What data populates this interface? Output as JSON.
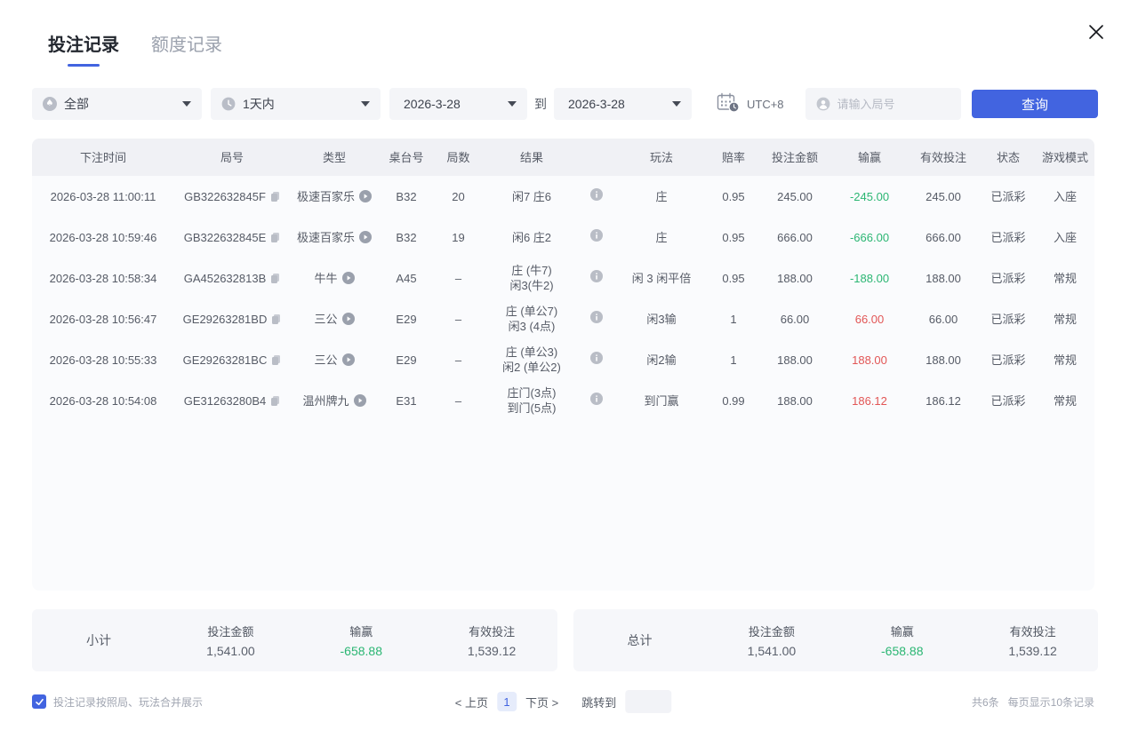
{
  "header": {
    "tabs": [
      {
        "label": "投注记录",
        "active": true
      },
      {
        "label": "额度记录",
        "active": false
      }
    ]
  },
  "filters": {
    "game_type": {
      "value": "全部",
      "icon": "spade-circle-icon"
    },
    "time_range": {
      "value": "1天内",
      "icon": "clock-icon"
    },
    "date_from": "2026-3-28",
    "to_label": "到",
    "date_to": "2026-3-28",
    "timezone": {
      "label": "UTC+8",
      "icon": "calendar-clock-icon"
    },
    "search": {
      "placeholder": "请输入局号",
      "icon": "person-icon"
    },
    "query_button": "查询"
  },
  "table": {
    "columns": [
      "下注时间",
      "局号",
      "类型",
      "桌台号",
      "局数",
      "结果",
      "",
      "玩法",
      "赔率",
      "投注金额",
      "输赢",
      "有效投注",
      "状态",
      "游戏模式"
    ],
    "rows": [
      {
        "time": "2026-03-28 11:00:11",
        "id": "GB322632845F",
        "type": "极速百家乐",
        "table_no": "B32",
        "rounds": "20",
        "result1": "闲7 庄6",
        "result2": "",
        "play": "庄",
        "odds": "0.95",
        "bet": "245.00",
        "winloss": "-245.00",
        "winloss_class": "neg",
        "valid": "245.00",
        "status": "已派彩",
        "mode": "入座"
      },
      {
        "time": "2026-03-28 10:59:46",
        "id": "GB322632845E",
        "type": "极速百家乐",
        "table_no": "B32",
        "rounds": "19",
        "result1": "闲6 庄2",
        "result2": "",
        "play": "庄",
        "odds": "0.95",
        "bet": "666.00",
        "winloss": "-666.00",
        "winloss_class": "neg",
        "valid": "666.00",
        "status": "已派彩",
        "mode": "入座"
      },
      {
        "time": "2026-03-28 10:58:34",
        "id": "GA452632813B",
        "type": "牛牛",
        "table_no": "A45",
        "rounds": "–",
        "result1": "庄 (牛7)",
        "result2": "闲3(牛2)",
        "play": "闲 3 闲平倍",
        "odds": "0.95",
        "bet": "188.00",
        "winloss": "-188.00",
        "winloss_class": "neg",
        "valid": "188.00",
        "status": "已派彩",
        "mode": "常规"
      },
      {
        "time": "2026-03-28 10:56:47",
        "id": "GE29263281BD",
        "type": "三公",
        "table_no": "E29",
        "rounds": "–",
        "result1": "庄 (单公7)",
        "result2": "闲3 (4点)",
        "play": "闲3输",
        "odds": "1",
        "bet": "66.00",
        "winloss": "66.00",
        "winloss_class": "pos",
        "valid": "66.00",
        "status": "已派彩",
        "mode": "常规"
      },
      {
        "time": "2026-03-28 10:55:33",
        "id": "GE29263281BC",
        "type": "三公",
        "table_no": "E29",
        "rounds": "–",
        "result1": "庄 (单公3)",
        "result2": "闲2 (单公2)",
        "play": "闲2输",
        "odds": "1",
        "bet": "188.00",
        "winloss": "188.00",
        "winloss_class": "pos",
        "valid": "188.00",
        "status": "已派彩",
        "mode": "常规"
      },
      {
        "time": "2026-03-28 10:54:08",
        "id": "GE31263280B4",
        "type": "温州牌九",
        "table_no": "E31",
        "rounds": "–",
        "result1": "庄门(3点)",
        "result2": "到门(5点)",
        "play": "到门赢",
        "odds": "0.99",
        "bet": "188.00",
        "winloss": "186.12",
        "winloss_class": "pos",
        "valid": "186.12",
        "status": "已派彩",
        "mode": "常规"
      }
    ]
  },
  "summary": {
    "subtotal": {
      "label": "小计",
      "bet_caption": "投注金额",
      "bet": "1,541.00",
      "winloss_caption": "输赢",
      "winloss": "-658.88",
      "winloss_class": "neg",
      "valid_caption": "有效投注",
      "valid": "1,539.12"
    },
    "total": {
      "label": "总计",
      "bet_caption": "投注金额",
      "bet": "1,541.00",
      "winloss_caption": "输赢",
      "winloss": "-658.88",
      "winloss_class": "neg",
      "valid_caption": "有效投注",
      "valid": "1,539.12"
    }
  },
  "footer": {
    "merge_checkbox": {
      "checked": true,
      "label": "投注记录按照局、玩法合并展示"
    },
    "pagination": {
      "prev": "< 上页",
      "page": "1",
      "next": "下页 >",
      "jump_label": "跳转到"
    },
    "total_records": "共6条",
    "per_page": "每页显示10条记录"
  },
  "colors": {
    "accent_blue": "#4264e0",
    "loss_green": "#2bb673",
    "win_red": "#e25656"
  }
}
